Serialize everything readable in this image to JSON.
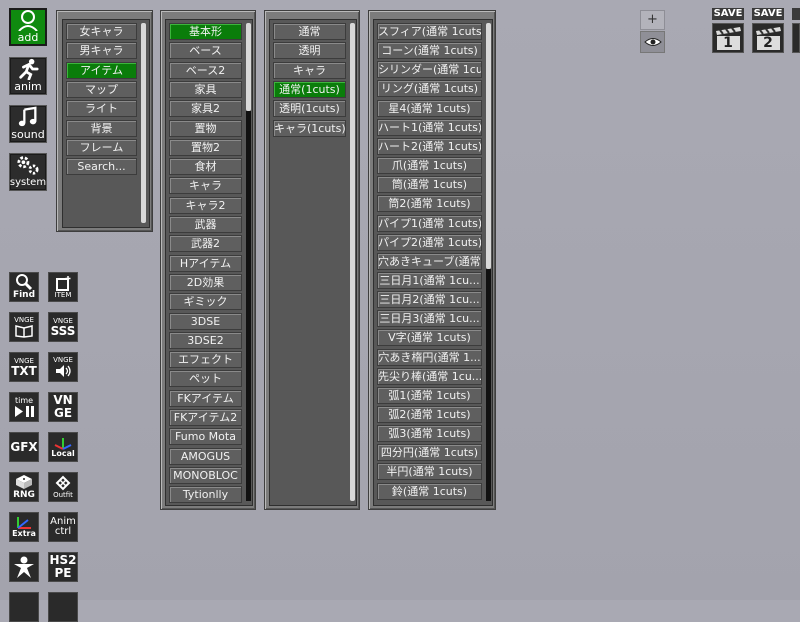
{
  "left_bar": {
    "add": "add",
    "anim": "anim",
    "sound": "sound",
    "system": "system"
  },
  "tools": {
    "find": "Find",
    "item": "ITEM",
    "vnge": "VNGE",
    "book": "",
    "sss": "SSS",
    "txt": "TXT",
    "time": "time",
    "vn": "VN",
    "ge": "GE",
    "gfx": "GFX",
    "local": "Local",
    "rng": "RNG",
    "outfit": "Outfit",
    "extra": "Extra",
    "anim": "Anim",
    "ctrl": "ctrl",
    "hs2": "HS2",
    "pe": "PE"
  },
  "panel1": {
    "items": [
      "女キャラ",
      "男キャラ",
      "アイテム",
      "マップ",
      "ライト",
      "背景",
      "フレーム",
      "Search..."
    ],
    "selected": 2
  },
  "panel2": {
    "items": [
      "基本形",
      "ベース",
      "ベース2",
      "家具",
      "家具2",
      "置物",
      "置物2",
      "食材",
      "キャラ",
      "キャラ2",
      "武器",
      "武器2",
      "Hアイテム",
      "2D効果",
      "ギミック",
      "3DSE",
      "3DSE2",
      "エフェクト",
      "ペット",
      "FKアイテム",
      "FKアイテム2",
      "Fumo Mota",
      "AMOGUS",
      "MONOBLOC",
      "Tytionlly"
    ],
    "selected": 0
  },
  "panel3": {
    "items": [
      "通常",
      "透明",
      "キャラ",
      "通常(1cuts)",
      "透明(1cuts)",
      "キャラ(1cuts)"
    ],
    "selected": 3
  },
  "panel4": {
    "items": [
      "スフィア(通常 1cuts)",
      "コーン(通常 1cuts)",
      "シリンダー(通常 1cu...",
      "リング(通常 1cuts)",
      "星4(通常 1cuts)",
      "ハート1(通常 1cuts)",
      "ハート2(通常 1cuts)",
      "爪(通常 1cuts)",
      "筒(通常 1cuts)",
      "筒2(通常 1cuts)",
      "パイプ1(通常 1cuts)",
      "パイプ2(通常 1cuts)",
      "穴あきキューブ(通常 ...",
      "三日月1(通常 1cu...",
      "三日月2(通常 1cu...",
      "三日月3(通常 1cu...",
      "V字(通常 1cuts)",
      "穴あき楕円(通常 1...",
      "先尖り棒(通常 1cu...",
      "弧1(通常 1cuts)",
      "弧2(通常 1cuts)",
      "弧3(通常 1cuts)",
      "四分円(通常 1cuts)",
      "半円(通常 1cuts)",
      "鈴(通常 1cuts)"
    ]
  },
  "top_right": {
    "plus": "+",
    "save1": "SAVE",
    "save2": "SAVE",
    "num1": "1",
    "num2": "2"
  },
  "colors": {
    "selected": "#0a7d0a",
    "button_bg": "#5f5f5f",
    "panel_bg": "#7c7c7c"
  }
}
